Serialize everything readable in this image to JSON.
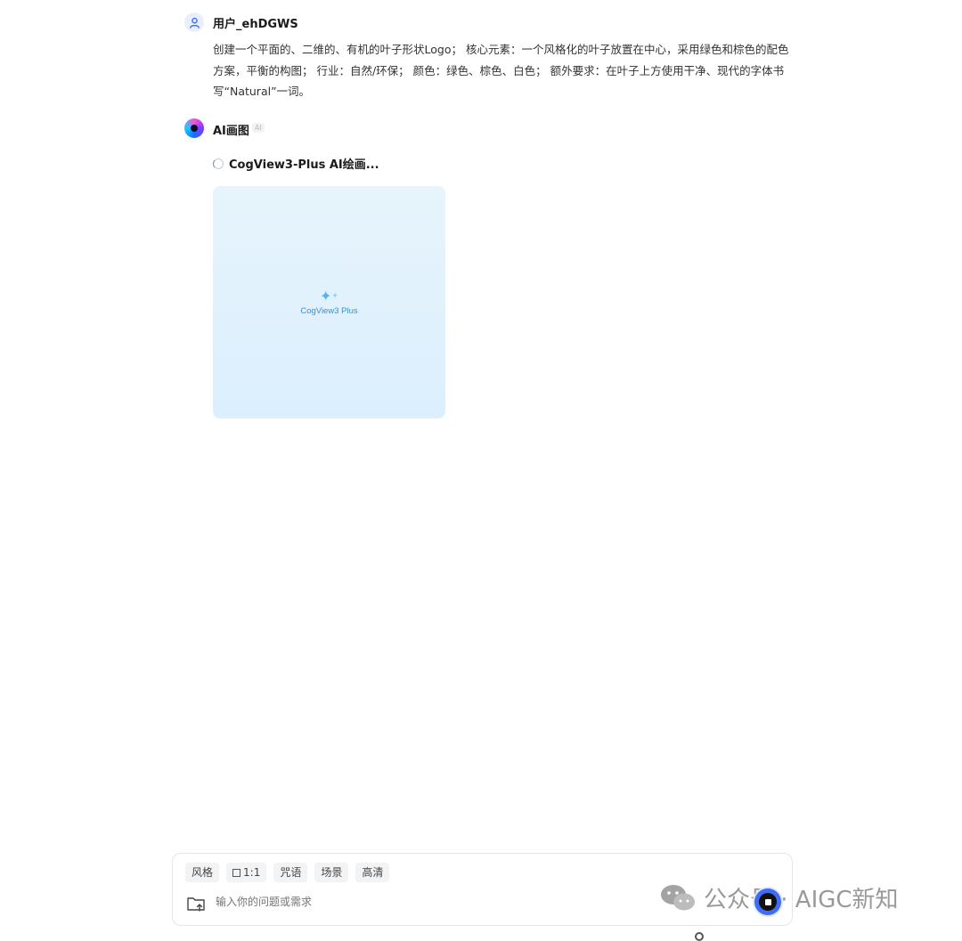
{
  "user_message": {
    "name": "用户_ehDGWS",
    "text": "创建一个平面的、二维的、有机的叶子形状Logo； 核心元素：一个风格化的叶子放置在中心，采用绿色和棕色的配色方案，平衡的构图； 行业：自然/环保； 颜色：绿色、棕色、白色； 额外要求：在叶子上方使用干净、现代的字体书写“Natural”一词。"
  },
  "ai_message": {
    "name": "AI画图",
    "badge": "AI",
    "status": "CogView3-Plus AI绘画...",
    "image_placeholder": {
      "brand": "CogView3 Plus"
    }
  },
  "composer": {
    "chips": [
      "风格",
      "1:1",
      "咒语",
      "场景",
      "高清"
    ],
    "input_placeholder": "输入你的问题或需求"
  },
  "watermark": {
    "text": "公众号 · AIGC新知"
  },
  "icons": {
    "user_avatar": "user-icon",
    "ai_avatar": "ai-orb-icon",
    "upload": "folder-upload-icon",
    "stop": "stop-icon",
    "watermark": "wechat-icon"
  },
  "colors": {
    "accent": "#3f6df5",
    "image_bg": "#e2f2fd",
    "brand_text": "#3a8fd8"
  }
}
